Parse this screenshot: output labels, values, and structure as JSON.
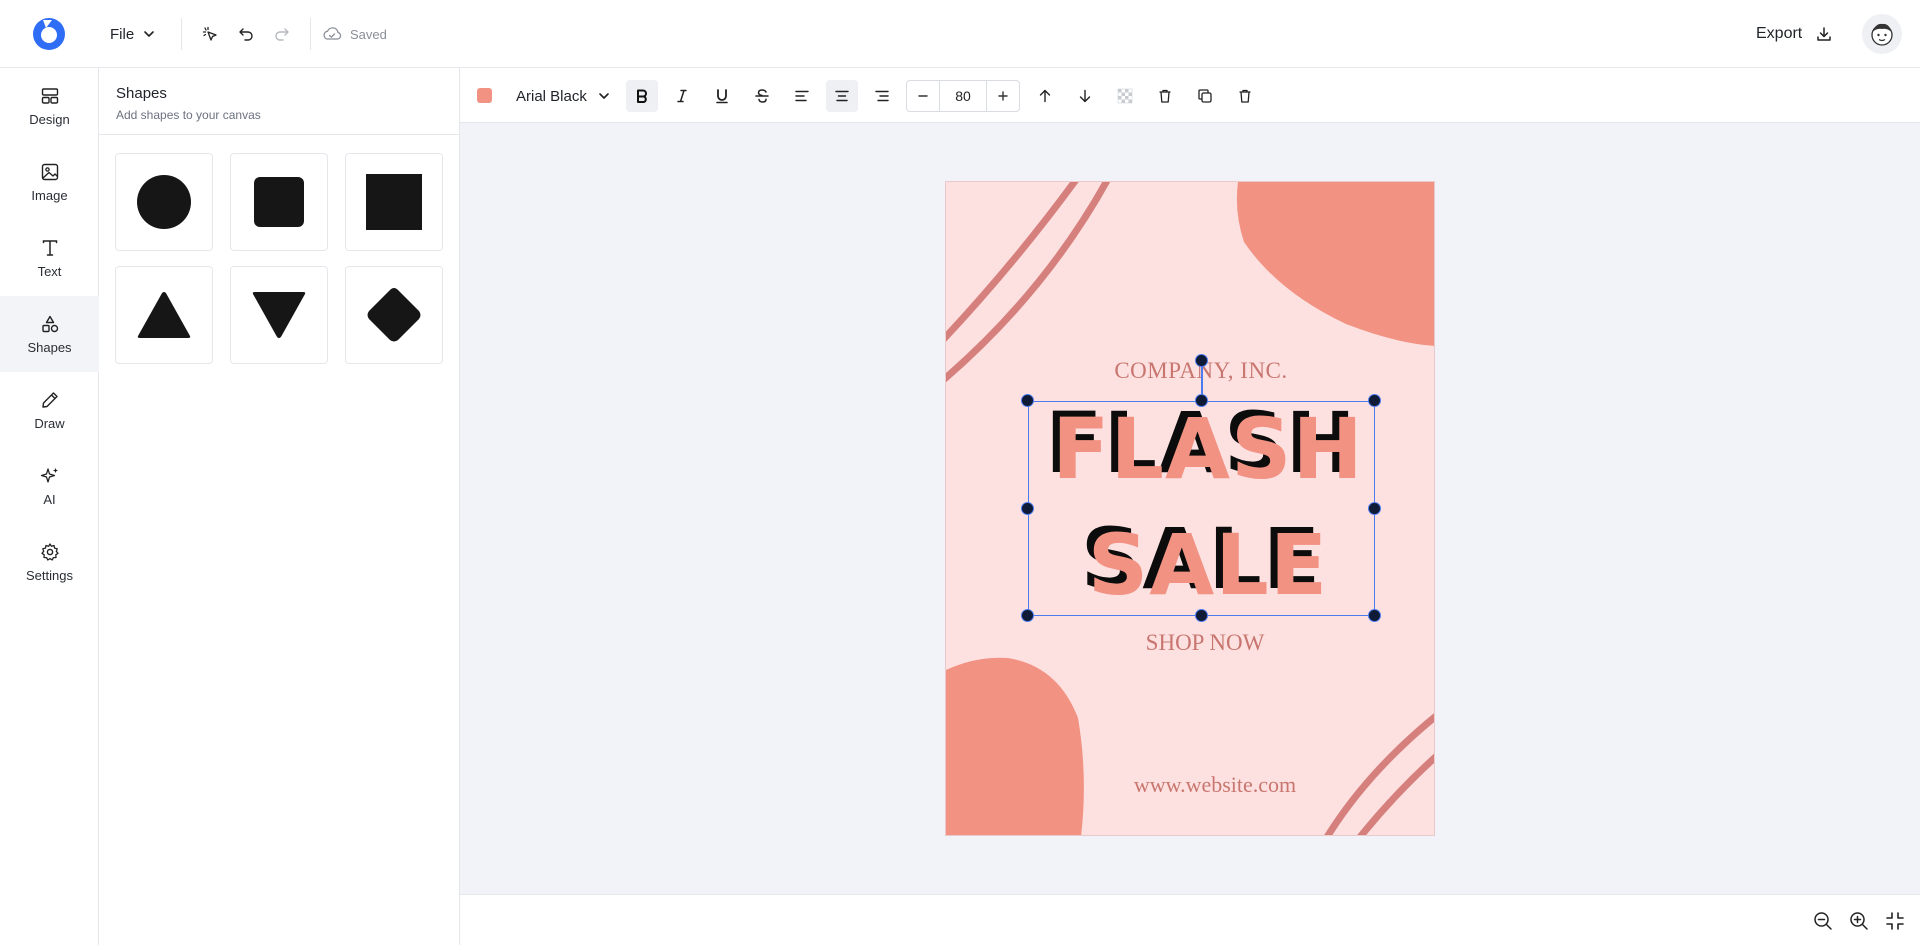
{
  "app": {
    "file_menu_label": "File",
    "save_status": "Saved",
    "export_label": "Export"
  },
  "rail": {
    "items": [
      {
        "label": "Design",
        "icon": "layout-icon"
      },
      {
        "label": "Image",
        "icon": "image-icon"
      },
      {
        "label": "Text",
        "icon": "text-icon"
      },
      {
        "label": "Shapes",
        "icon": "shapes-icon",
        "active": true
      },
      {
        "label": "Draw",
        "icon": "pencil-icon"
      },
      {
        "label": "AI",
        "icon": "sparkle-icon"
      },
      {
        "label": "Settings",
        "icon": "gear-icon"
      }
    ]
  },
  "panel": {
    "title": "Shapes",
    "subtitle": "Add shapes to your canvas",
    "shapes": [
      "circle",
      "rounded-square",
      "square",
      "triangle",
      "inverted-triangle",
      "diamond"
    ]
  },
  "format": {
    "text_color": "#f29283",
    "font_family": "Arial Black",
    "font_size": "80",
    "bold": true,
    "align": "center"
  },
  "poster": {
    "company": "COMPANY, INC.",
    "headline_line1": "FLASH",
    "headline_line2": "SALE",
    "cta": "SHOP NOW",
    "website": "www.website.com",
    "background": "#fde1e1",
    "accent": "#f29283",
    "text_color": "#c8766f"
  }
}
